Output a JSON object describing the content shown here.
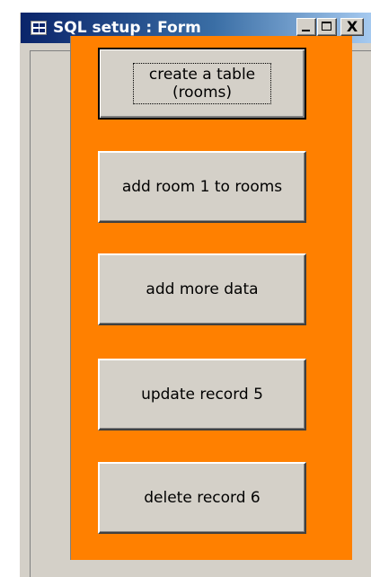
{
  "window": {
    "title": "SQL setup : Form",
    "controls": {
      "minimize_icon": "minimize-icon",
      "maximize_icon": "maximize-icon",
      "close_glyph": "X"
    }
  },
  "form": {
    "background_color": "#ff8000",
    "buttons": [
      {
        "label": "create a table (rooms)",
        "focused": true
      },
      {
        "label": "add room 1 to rooms",
        "focused": false
      },
      {
        "label": "add more data",
        "focused": false
      },
      {
        "label": "update record 5",
        "focused": false
      },
      {
        "label": "delete record 6",
        "focused": false
      }
    ]
  }
}
